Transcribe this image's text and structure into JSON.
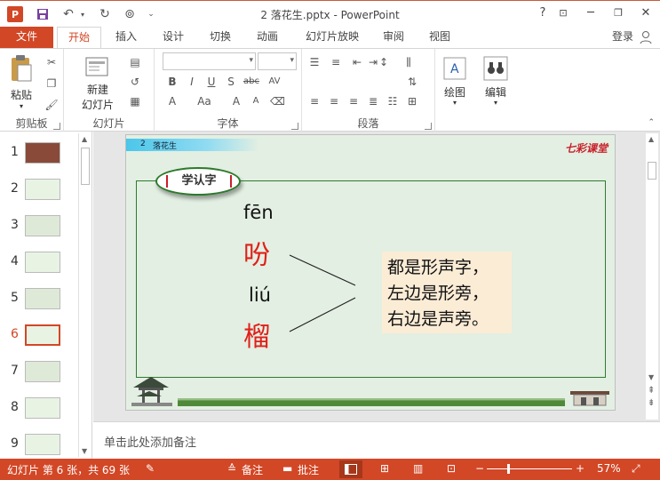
{
  "window": {
    "title": "2 落花生.pptx - PowerPoint",
    "help": "?",
    "logo": "P"
  },
  "tabs": [
    "文件",
    "开始",
    "插入",
    "设计",
    "切换",
    "动画",
    "幻灯片放映",
    "审阅",
    "视图"
  ],
  "account": {
    "login": "登录"
  },
  "ribbon": {
    "clipboard": {
      "paste": "粘贴",
      "label": "剪贴板"
    },
    "slides": {
      "new_slide_1": "新建",
      "new_slide_2": "幻灯片",
      "label": "幻灯片"
    },
    "font": {
      "label": "字体",
      "bold": "B",
      "italic": "I",
      "underline": "U",
      "shadow": "S",
      "strike": "abc",
      "spacing": "AV",
      "change_case": "Aa",
      "grow": "A",
      "shrink": "A"
    },
    "paragraph": {
      "label": "段落"
    },
    "drawing": {
      "label": "绘图"
    },
    "editing": {
      "label": "编辑"
    }
  },
  "thumbnails": [
    {
      "num": "1"
    },
    {
      "num": "2"
    },
    {
      "num": "3"
    },
    {
      "num": "4"
    },
    {
      "num": "5"
    },
    {
      "num": "6"
    },
    {
      "num": "7"
    },
    {
      "num": "8"
    },
    {
      "num": "9"
    }
  ],
  "active_slide_index": 5,
  "slide": {
    "header_num": "2",
    "header_title": "落花生",
    "brand": "七彩课堂",
    "badge": "学认字",
    "pinyin_1": "fēn",
    "char_1": "吩",
    "pinyin_2": "liú",
    "char_2": "榴",
    "explain": [
      "都是形声字，",
      "左边是形旁，",
      "右边是声旁。"
    ]
  },
  "notes": {
    "placeholder": "单击此处添加备注"
  },
  "status": {
    "slide_info": "幻灯片 第 6 张，共 69 张",
    "notes_btn": "备注",
    "comments_btn": "批注",
    "zoom": "57%",
    "zoom_minus": "−",
    "zoom_plus": "+"
  },
  "colors": {
    "accent": "#d24726",
    "slide_bg": "#e3efe2",
    "border_green": "#2f7a2f",
    "red_char": "#e0201a",
    "explain_bg": "#fbecd6"
  }
}
